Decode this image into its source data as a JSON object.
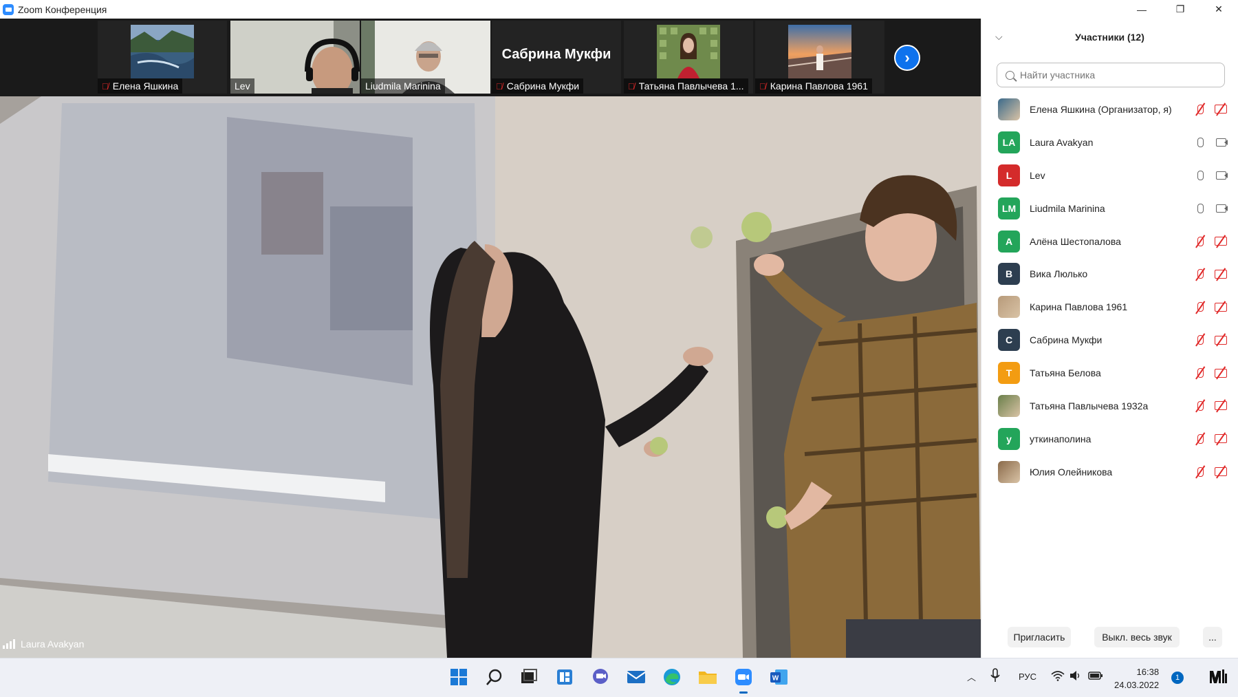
{
  "window": {
    "title": "Zoom Конференция",
    "controls": {
      "minimize": "—",
      "restore": "❐",
      "close": "✕"
    }
  },
  "thumbnails": [
    {
      "name": "Елена Яшкина",
      "muted": true
    },
    {
      "name": "Lev",
      "muted": false
    },
    {
      "name": "Liudmila Marinina",
      "muted": false
    },
    {
      "name": "Сабрина Мукфи",
      "muted": true,
      "big_name": "Сабрина Мукфи"
    },
    {
      "name": "Татьяна Павлычева 1...",
      "muted": true
    },
    {
      "name": "Карина Павлова 1961",
      "muted": true
    }
  ],
  "next_page_icon": "chevron-right-icon",
  "main_video": {
    "speaker": "Laura Avakyan"
  },
  "participants_panel": {
    "title": "Участники (12)",
    "search_placeholder": "Найти участника",
    "participants": [
      {
        "initials": "",
        "name": "Елена Яшкина (Организатор, я)",
        "color": "#3b6a8a",
        "photo": true,
        "mic": "off",
        "cam": "off"
      },
      {
        "initials": "LA",
        "name": "Laura Avakyan",
        "color": "#23a55a",
        "mic": "on",
        "cam": "on"
      },
      {
        "initials": "L",
        "name": "Lev",
        "color": "#d42b2b",
        "mic": "on",
        "cam": "on"
      },
      {
        "initials": "LM",
        "name": "Liudmila Marinina",
        "color": "#23a55a",
        "mic": "on",
        "cam": "on"
      },
      {
        "initials": "А",
        "name": "Алёна Шестопалова",
        "color": "#23a55a",
        "mic": "off",
        "cam": "off"
      },
      {
        "initials": "В",
        "name": "Вика Люлько",
        "color": "#2d3e50",
        "mic": "off",
        "cam": "off"
      },
      {
        "initials": "",
        "name": "Карина Павлова 1961",
        "color": "#b79a7a",
        "photo": true,
        "mic": "off",
        "cam": "off"
      },
      {
        "initials": "С",
        "name": "Сабрина Мукфи",
        "color": "#2d3e50",
        "mic": "off",
        "cam": "off"
      },
      {
        "initials": "Т",
        "name": "Татьяна Белова",
        "color": "#f39c12",
        "mic": "off",
        "cam": "off"
      },
      {
        "initials": "",
        "name": "Татьяна Павлычева 1932а",
        "color": "#6a7f4a",
        "photo": true,
        "mic": "off",
        "cam": "off"
      },
      {
        "initials": "у",
        "name": "уткинаполина",
        "color": "#23a55a",
        "mic": "off",
        "cam": "off"
      },
      {
        "initials": "",
        "name": "Юлия Олейникова",
        "color": "#8a6a4a",
        "photo": true,
        "mic": "off",
        "cam": "off"
      }
    ],
    "footer": {
      "invite": "Пригласить",
      "mute_all": "Выкл. весь звук",
      "more": "..."
    }
  },
  "taskbar": {
    "language": "РУС",
    "time": "16:38",
    "date": "24.03.2022",
    "notifications": "1"
  }
}
